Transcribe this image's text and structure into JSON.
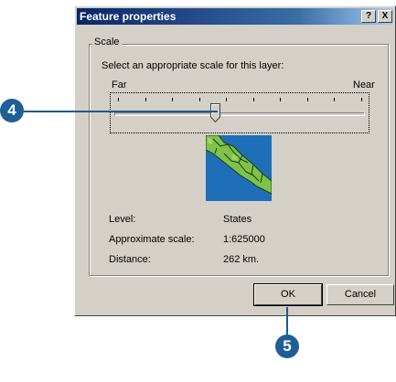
{
  "window": {
    "title": "Feature properties",
    "help_label": "?",
    "close_label": "X"
  },
  "scale_group": {
    "legend": "Scale",
    "instruction": "Select an appropriate scale for this layer:",
    "far_label": "Far",
    "near_label": "Near",
    "slider_position": 0.4,
    "tick_count": 10
  },
  "info": {
    "level_label": "Level:",
    "level_value": "States",
    "scale_label": "Approximate scale:",
    "scale_value": "1:625000",
    "distance_label": "Distance:",
    "distance_value": "262 km."
  },
  "buttons": {
    "ok_label": "OK",
    "cancel_label": "Cancel"
  },
  "callouts": {
    "slider_step": "4",
    "ok_step": "5"
  },
  "colors": {
    "callout": "#1f5f96",
    "titlebar": "#0a246a",
    "map_water": "#1e6fb8",
    "map_land": "#7fc24a"
  }
}
